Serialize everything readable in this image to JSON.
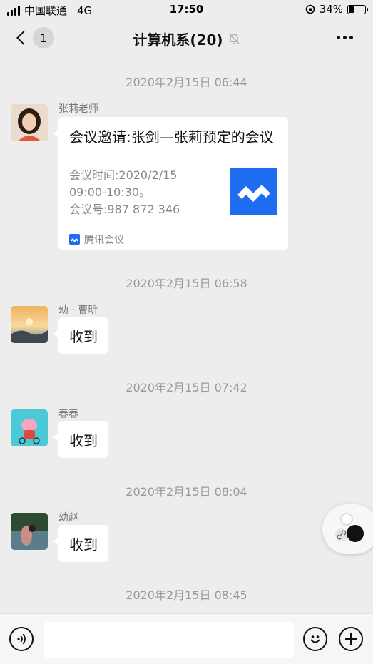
{
  "status_bar": {
    "carrier": "中国联通",
    "network": "4G",
    "time": "17:50",
    "battery": "34%",
    "battery_level": 0.34
  },
  "header": {
    "back_badge": "1",
    "title": "计算机系(20)",
    "muted_icon": "bell-slash-icon",
    "more_icon": "more-dots-icon"
  },
  "messages": [
    {
      "time": "2020年2月15日 06:44",
      "sender": "张莉老师",
      "type": "card",
      "card": {
        "title": "会议邀请:张剑—张莉预定的会议",
        "desc_line1": "会议时间:2020/2/15",
        "desc_line2": "09:00-10:30。",
        "desc_line3": "会议号:987 872 346",
        "source": "腾讯会议"
      }
    },
    {
      "time": "2020年2月15日 06:58",
      "sender": "幼 · 曹昕",
      "type": "text",
      "text": "收到"
    },
    {
      "time": "2020年2月15日 07:42",
      "sender": "春春",
      "type": "text",
      "text": "收到"
    },
    {
      "time": "2020年2月15日 08:04",
      "sender": "幼赵",
      "type": "text",
      "text": "收到"
    },
    {
      "time": "2020年2月15日 08:45"
    }
  ],
  "input_bar": {
    "voice_icon": "voice-icon",
    "emoji_icon": "emoji-icon",
    "add_icon": "plus-icon"
  },
  "colors": {
    "background": "#ededed",
    "bubble": "#ffffff",
    "tencent_meeting_blue": "#1e6cf0"
  }
}
